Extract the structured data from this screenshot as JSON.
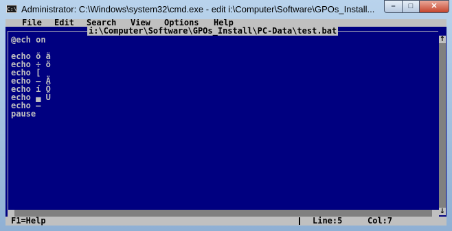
{
  "window": {
    "title": "Administrator: C:\\Windows\\system32\\cmd.exe - edit  i:\\Computer\\Software\\GPOs_Install...",
    "icon": "C:\\"
  },
  "caption_buttons": {
    "minimize": "–",
    "maximize": "□",
    "close": "✕"
  },
  "menu": [
    "File",
    "Edit",
    "Search",
    "View",
    "Options",
    "Help"
  ],
  "editor": {
    "file_path": "i:\\Computer\\Software\\GPOs_Install\\PC-Data\\test.bat",
    "lines": [
      "@ech on",
      "",
      "echo õ ä",
      "echo ÷ ö",
      "echo [",
      "echo – Ä",
      "echo í Ö",
      "echo ▄ Ü",
      "echo –",
      "pause"
    ]
  },
  "scrollbar": {
    "up": "↑",
    "down": "↓"
  },
  "status": {
    "help": "F1=Help",
    "line": "Line:5",
    "col": "Col:7"
  },
  "colors": {
    "background": "#000080",
    "text": "#c0c0c0",
    "menu_bg": "#c0c0c0"
  }
}
